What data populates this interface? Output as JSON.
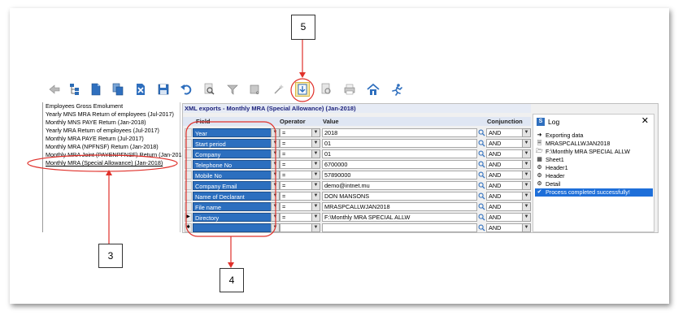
{
  "left_list": {
    "items": [
      "Employees Gross Emolument",
      "Yearly MNS MRA Return of employees (Jul-2017)",
      "Monthly MNS PAYE Return (Jan-2018)",
      "Yearly MRA Return of employees (Jul-2017)",
      "Monthly MRA PAYE Return (Jul-2017)",
      "Monthly MRA (NPFNSF) Return (Jan-2018)",
      "Monthly MRA Joint (PAYENPFNSF) Return (Jan-2018)",
      "Monthly MRA (Special Allowance) (Jan-2018)"
    ]
  },
  "xml_panel": {
    "title": "XML exports - Monthly MRA (Special Allowance) (Jan-2018)",
    "headers": {
      "field": "Field",
      "operator": "Operator",
      "value": "Value",
      "conjunction": "Conjunction"
    },
    "rows": [
      {
        "field": "Year",
        "operator": "=",
        "value": "2018",
        "conjunction": "AND",
        "marker": ""
      },
      {
        "field": "Start period",
        "operator": "=",
        "value": "01",
        "conjunction": "AND",
        "marker": ""
      },
      {
        "field": "Company",
        "operator": "=",
        "value": "01",
        "conjunction": "AND",
        "marker": ""
      },
      {
        "field": "Telephone No",
        "operator": "=",
        "value": "6700000",
        "conjunction": "AND",
        "marker": ""
      },
      {
        "field": "Mobile No",
        "operator": "=",
        "value": "57890000",
        "conjunction": "AND",
        "marker": ""
      },
      {
        "field": "Company Email",
        "operator": "=",
        "value": "demo@intnet.mu",
        "conjunction": "AND",
        "marker": ""
      },
      {
        "field": "Name of Declarant",
        "operator": "=",
        "value": "DON MANSONS",
        "conjunction": "AND",
        "marker": ""
      },
      {
        "field": "File name",
        "operator": "=",
        "value": "MRASPCALLWJAN2018",
        "conjunction": "AND",
        "marker": ""
      },
      {
        "field": "Directory",
        "operator": "=",
        "value": "F:\\Monthly MRA SPECIAL ALLW",
        "conjunction": "AND",
        "marker": "▶"
      },
      {
        "field": "",
        "operator": "",
        "value": "",
        "conjunction": "AND",
        "marker": "✱"
      }
    ]
  },
  "log": {
    "title": "Log",
    "close_label": "✕",
    "items": [
      {
        "icon": "arrow-right-icon",
        "text": "Exporting data"
      },
      {
        "icon": "file-icon",
        "text": "MRASPCALLWJAN2018"
      },
      {
        "icon": "folder-icon",
        "text": "F:\\Monthly MRA SPECIAL ALLW"
      },
      {
        "icon": "sheet-icon",
        "text": "Sheet1"
      },
      {
        "icon": "gear-icon",
        "text": "Header1"
      },
      {
        "icon": "gear-icon",
        "text": "Header"
      },
      {
        "icon": "gear-icon",
        "text": "Detail"
      },
      {
        "icon": "check-icon",
        "text": "Process completed successfully!"
      }
    ]
  },
  "annotations": {
    "a3": "3",
    "a4": "4",
    "a5": "5"
  },
  "colors": {
    "accent_red": "#e0302a",
    "field_blue": "#2c6fbf",
    "title_navy": "#1a1f7a",
    "selection": "#1e6fd9"
  },
  "toolbar_icons": [
    "back-icon",
    "tree-icon",
    "document-icon",
    "copy-icon",
    "delete-icon",
    "save-icon",
    "undo-icon",
    "search-doc-icon",
    "filter-icon",
    "tools-icon",
    "magic-icon",
    "export-icon",
    "preview-icon",
    "print-icon",
    "home-icon",
    "run-icon"
  ]
}
